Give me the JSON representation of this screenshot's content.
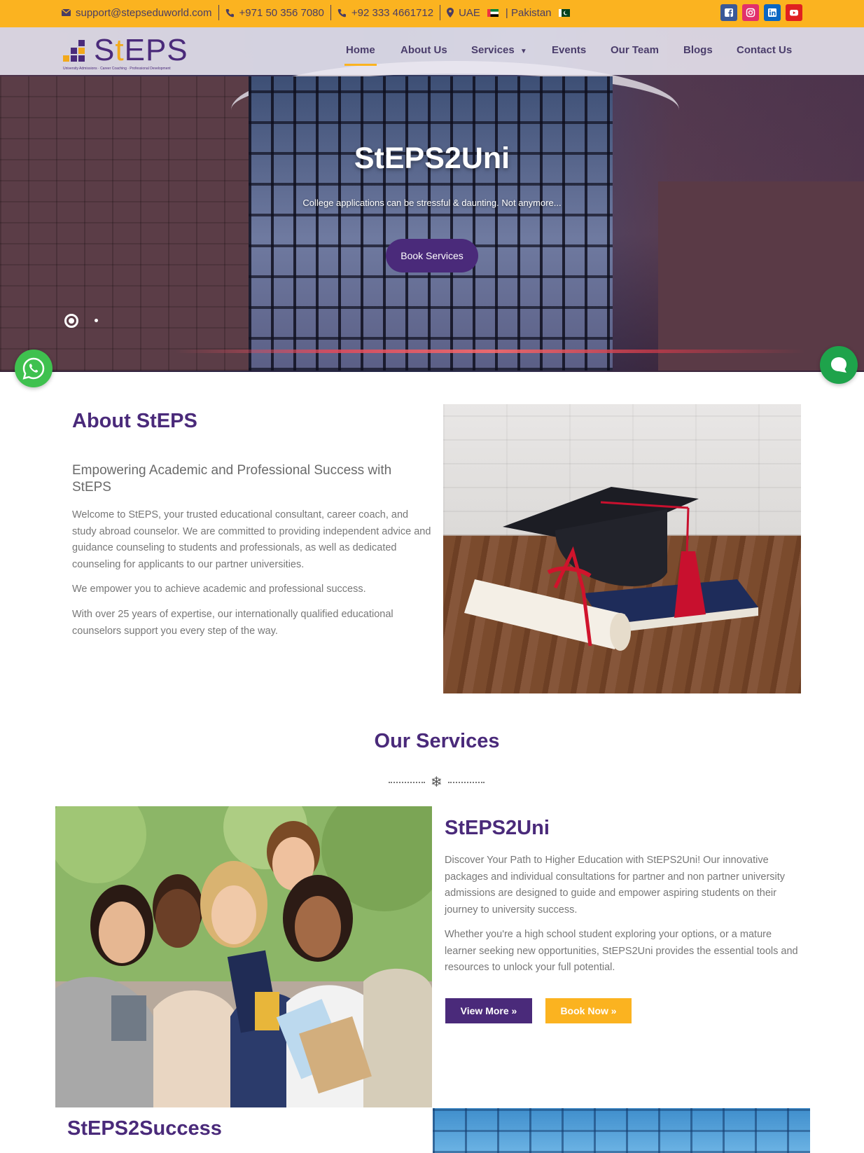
{
  "topbar": {
    "email": "support@stepseduworld.com",
    "phone1": "+971 50 356 7080",
    "phone2": "+92 333 4661712",
    "location": "UAE",
    "location2": "| Pakistan",
    "bg_color": "#fbb320"
  },
  "social": [
    {
      "name": "facebook-icon",
      "color": "#3b5998"
    },
    {
      "name": "instagram-icon",
      "color": "#e1306c"
    },
    {
      "name": "linkedin-icon",
      "color": "#0a66c2"
    },
    {
      "name": "youtube-icon",
      "color": "#e02020"
    }
  ],
  "logo": {
    "brand_prefix": "S",
    "brand_t": "t",
    "brand_suffix": "EPS",
    "tagline": "University Admissions · Career Coaching · Professional Development"
  },
  "nav": {
    "home": "Home",
    "about": "About Us",
    "services": "Services",
    "events": "Events",
    "team": "Our Team",
    "blogs": "Blogs",
    "contact": "Contact Us",
    "active": "Home"
  },
  "hero": {
    "title": "StEPS2Uni",
    "subtitle": "College applications can be stressful & daunting. Not anymore...",
    "button": "Book Services",
    "slides_count": 2,
    "active_slide": 1
  },
  "about": {
    "heading": "About StEPS",
    "subheading": "Empowering Academic and Professional Success with StEPS",
    "p1": "Welcome to StEPS, your trusted educational consultant, career coach, and study abroad counselor. We are committed to providing independent advice and guidance counseling to students and professionals, as well as dedicated counseling for applicants to our partner universities.",
    "p2": "We empower you to achieve academic and professional success.",
    "p3": "With over 25 years of expertise, our internationally qualified educational counselors support you every step of the way."
  },
  "services": {
    "heading": "Our Services",
    "divider_icon": "snowflake-icon",
    "item1": {
      "title": "StEPS2Uni",
      "p1": "Discover Your Path to Higher Education with StEPS2Uni! Our innovative packages and individual consultations for partner and non partner university admissions are designed to guide and empower aspiring students on their journey to university success.",
      "p2": "Whether you're a high school student exploring your options, or a mature learner seeking new opportunities, StEPS2Uni provides the essential tools and resources to unlock your full potential.",
      "view_more": "View More »",
      "book_now": "Book Now »"
    },
    "item2": {
      "title": "StEPS2Success"
    }
  },
  "colors": {
    "brand_purple": "#4a2a7a",
    "brand_yellow": "#fbb320",
    "whatsapp_green": "#3fc14f",
    "chat_green": "#1ea34b"
  }
}
